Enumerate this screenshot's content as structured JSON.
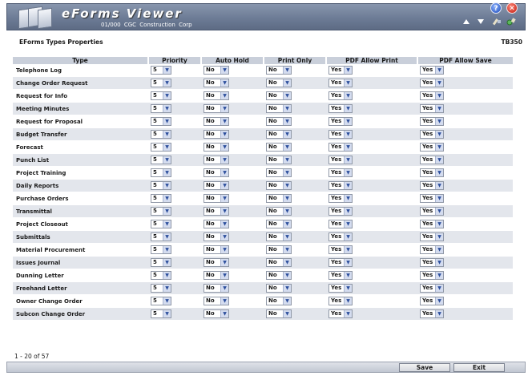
{
  "header": {
    "app_title": "eForms Viewer",
    "subtitle": "01/000  CGC Construction Corp",
    "help_glyph": "?",
    "close_glyph": "✕",
    "icons": [
      "help-icon",
      "close-icon",
      "arrow-up-icon",
      "arrow-down-icon",
      "edit-icon",
      "settings-icon"
    ]
  },
  "section": {
    "title": "EForms Types Properties",
    "code": "TB350"
  },
  "table": {
    "columns": [
      "Type",
      "Priority",
      "Auto Hold",
      "Print Only",
      "PDF Allow Print",
      "PDF Allow Save"
    ],
    "rows": [
      {
        "type": "Telephone Log",
        "priority": "5",
        "auto_hold": "No",
        "print_only": "No",
        "pdf_print": "Yes",
        "pdf_save": "Yes"
      },
      {
        "type": "Change Order Request",
        "priority": "5",
        "auto_hold": "No",
        "print_only": "No",
        "pdf_print": "Yes",
        "pdf_save": "Yes"
      },
      {
        "type": "Request for Info",
        "priority": "5",
        "auto_hold": "No",
        "print_only": "No",
        "pdf_print": "Yes",
        "pdf_save": "Yes"
      },
      {
        "type": "Meeting Minutes",
        "priority": "5",
        "auto_hold": "No",
        "print_only": "No",
        "pdf_print": "Yes",
        "pdf_save": "Yes"
      },
      {
        "type": "Request for Proposal",
        "priority": "5",
        "auto_hold": "No",
        "print_only": "No",
        "pdf_print": "Yes",
        "pdf_save": "Yes"
      },
      {
        "type": "Budget Transfer",
        "priority": "5",
        "auto_hold": "No",
        "print_only": "No",
        "pdf_print": "Yes",
        "pdf_save": "Yes"
      },
      {
        "type": "Forecast",
        "priority": "5",
        "auto_hold": "No",
        "print_only": "No",
        "pdf_print": "Yes",
        "pdf_save": "Yes"
      },
      {
        "type": "Punch List",
        "priority": "5",
        "auto_hold": "No",
        "print_only": "No",
        "pdf_print": "Yes",
        "pdf_save": "Yes"
      },
      {
        "type": "Project Training",
        "priority": "5",
        "auto_hold": "No",
        "print_only": "No",
        "pdf_print": "Yes",
        "pdf_save": "Yes"
      },
      {
        "type": "Daily Reports",
        "priority": "5",
        "auto_hold": "No",
        "print_only": "No",
        "pdf_print": "Yes",
        "pdf_save": "Yes"
      },
      {
        "type": "Purchase Orders",
        "priority": "5",
        "auto_hold": "No",
        "print_only": "No",
        "pdf_print": "Yes",
        "pdf_save": "Yes"
      },
      {
        "type": "Transmittal",
        "priority": "5",
        "auto_hold": "No",
        "print_only": "No",
        "pdf_print": "Yes",
        "pdf_save": "Yes"
      },
      {
        "type": "Project Closeout",
        "priority": "5",
        "auto_hold": "No",
        "print_only": "No",
        "pdf_print": "Yes",
        "pdf_save": "Yes"
      },
      {
        "type": "Submittals",
        "priority": "5",
        "auto_hold": "No",
        "print_only": "No",
        "pdf_print": "Yes",
        "pdf_save": "Yes"
      },
      {
        "type": "Material Procurement",
        "priority": "5",
        "auto_hold": "No",
        "print_only": "No",
        "pdf_print": "Yes",
        "pdf_save": "Yes"
      },
      {
        "type": "Issues Journal",
        "priority": "5",
        "auto_hold": "No",
        "print_only": "No",
        "pdf_print": "Yes",
        "pdf_save": "Yes"
      },
      {
        "type": "Dunning Letter",
        "priority": "5",
        "auto_hold": "No",
        "print_only": "No",
        "pdf_print": "Yes",
        "pdf_save": "Yes"
      },
      {
        "type": "Freehand Letter",
        "priority": "5",
        "auto_hold": "No",
        "print_only": "No",
        "pdf_print": "Yes",
        "pdf_save": "Yes"
      },
      {
        "type": "Owner Change Order",
        "priority": "5",
        "auto_hold": "No",
        "print_only": "No",
        "pdf_print": "Yes",
        "pdf_save": "Yes"
      },
      {
        "type": "Subcon Change Order",
        "priority": "5",
        "auto_hold": "No",
        "print_only": "No",
        "pdf_print": "Yes",
        "pdf_save": "Yes"
      }
    ]
  },
  "footer": {
    "page_info": "1 - 20 of 57",
    "save_label": "Save",
    "exit_label": "Exit"
  },
  "colors": {
    "header": "#6d7c96",
    "row_alt": "#e3e6ec",
    "column_header": "#c9cfda"
  }
}
